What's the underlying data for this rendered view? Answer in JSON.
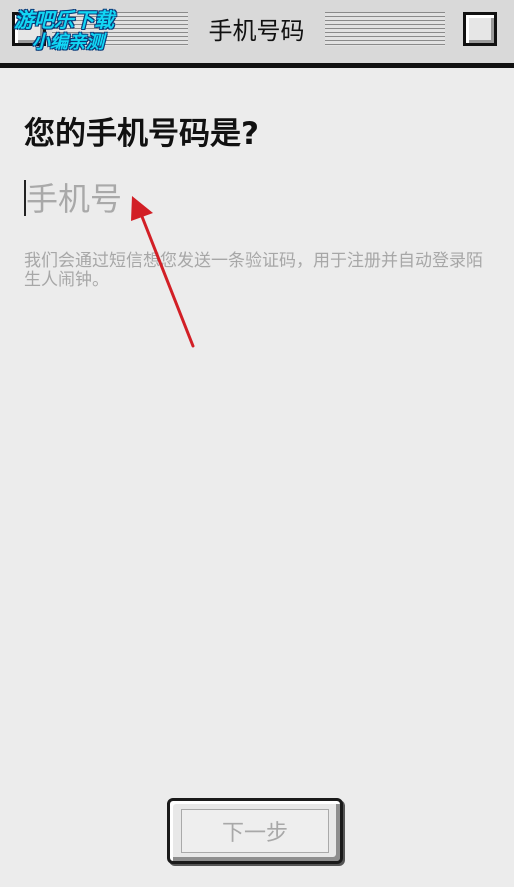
{
  "window": {
    "title": "手机号码",
    "watermark_line1": "游吧乐下载",
    "watermark_line2": "小编亲测"
  },
  "main": {
    "heading": "您的手机号码是?",
    "phone_input": {
      "placeholder": "手机号",
      "value": ""
    },
    "hint": "我们会通过短信想您发送一条验证码，用于注册并自动登录陌生人闹钟。"
  },
  "footer": {
    "next_label": "下一步"
  },
  "colors": {
    "background": "#ececec",
    "annotation_arrow": "#d21f26",
    "watermark": "#12d6f4"
  }
}
